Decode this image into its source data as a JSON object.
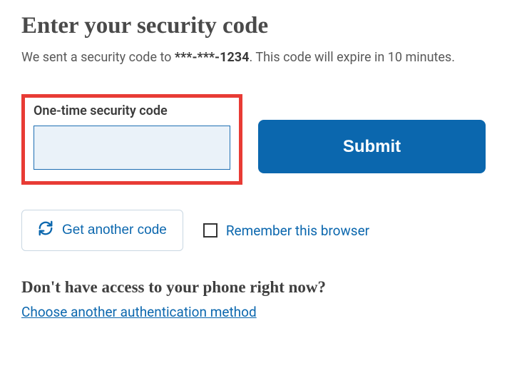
{
  "title": "Enter your security code",
  "instruction_prefix": "We sent a security code to ",
  "masked_phone": "***-***-1234",
  "instruction_suffix": ". This code will expire in 10 minutes.",
  "input": {
    "label": "One-time security code",
    "value": ""
  },
  "submit_label": "Submit",
  "another_code_label": "Get another code",
  "remember_label": "Remember this browser",
  "remember_checked": false,
  "noaccess_title": "Don't have access to your phone right now?",
  "choose_method_label": "Choose another authentication method",
  "colors": {
    "accent": "#0b67ae",
    "highlight_border": "#e83b35"
  }
}
